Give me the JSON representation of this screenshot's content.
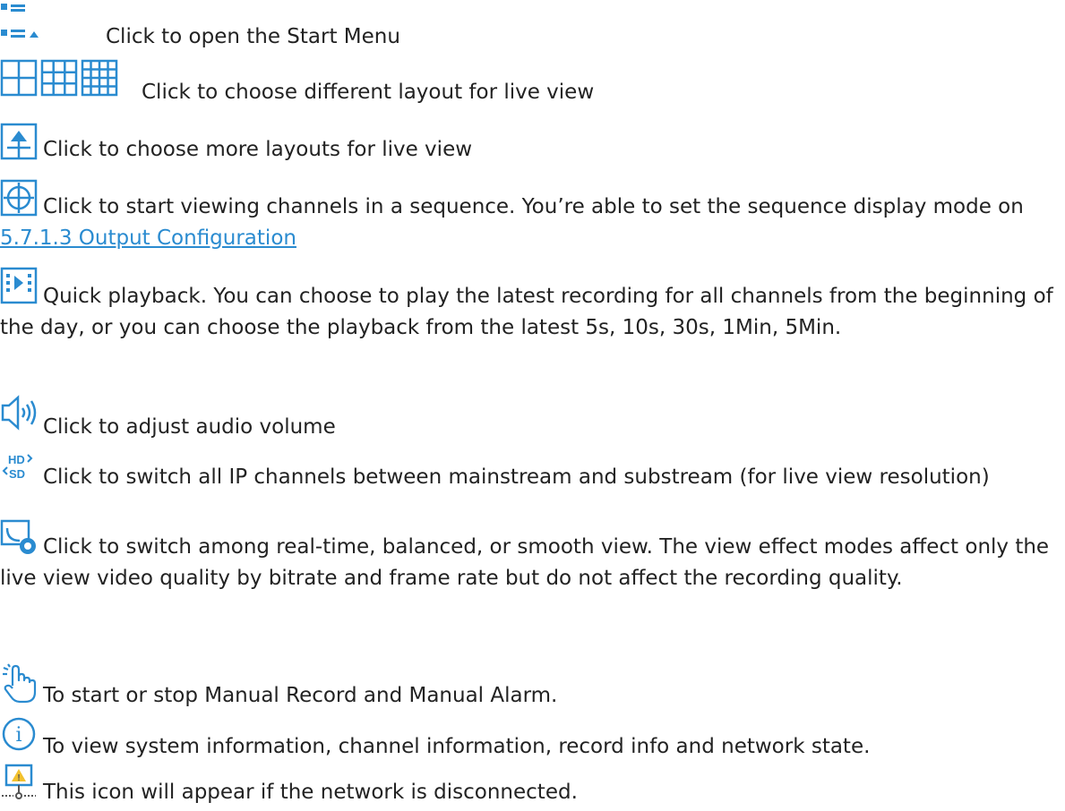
{
  "items": [
    {
      "icon": "start-menu-icon",
      "text": "Click to open the Start Menu"
    },
    {
      "icon": "layout-grid-icons",
      "text": "Click to choose different layout for live view"
    },
    {
      "icon": "more-layouts-icon",
      "text": "Click to choose more layouts for live view"
    },
    {
      "icon": "sequence-view-icon",
      "text": "Click to start viewing channels in a sequence. You’re able to set the sequence display mode on ",
      "link": "5.7.1.3 Output Configuration"
    },
    {
      "icon": "quick-playback-icon",
      "text": "Quick playback. You can choose to play the latest recording for all channels from the beginning of the day, or you can choose the playback from the latest 5s, 10s, 30s, 1Min, 5Min."
    },
    {
      "icon": "audio-volume-icon",
      "text": "Click to adjust audio volume"
    },
    {
      "icon": "hd-sd-switch-icon",
      "text": "Click to switch all IP channels between mainstream and substream (for live view resolution)",
      "icon_text_top": "HD",
      "icon_text_bottom": "SD"
    },
    {
      "icon": "view-effect-icon",
      "text": "Click to switch among real-time, balanced, or smooth view. The view effect modes affect only the live view video quality by bitrate and frame rate but do not affect the recording quality."
    },
    {
      "icon": "manual-record-hand-icon",
      "text": "To start or stop Manual Record and Manual Alarm."
    },
    {
      "icon": "info-icon",
      "text": "To view system information, channel information, record info and network state.",
      "icon_glyph": "i"
    },
    {
      "icon": "network-disconnected-icon",
      "text": "This icon will appear if the network is disconnected.",
      "icon_glyph": "!"
    }
  ],
  "colors": {
    "icon_blue": "#2a8bd0",
    "link_blue": "#2a8bd0",
    "warning_yellow": "#f2c12e",
    "text": "#222222"
  }
}
